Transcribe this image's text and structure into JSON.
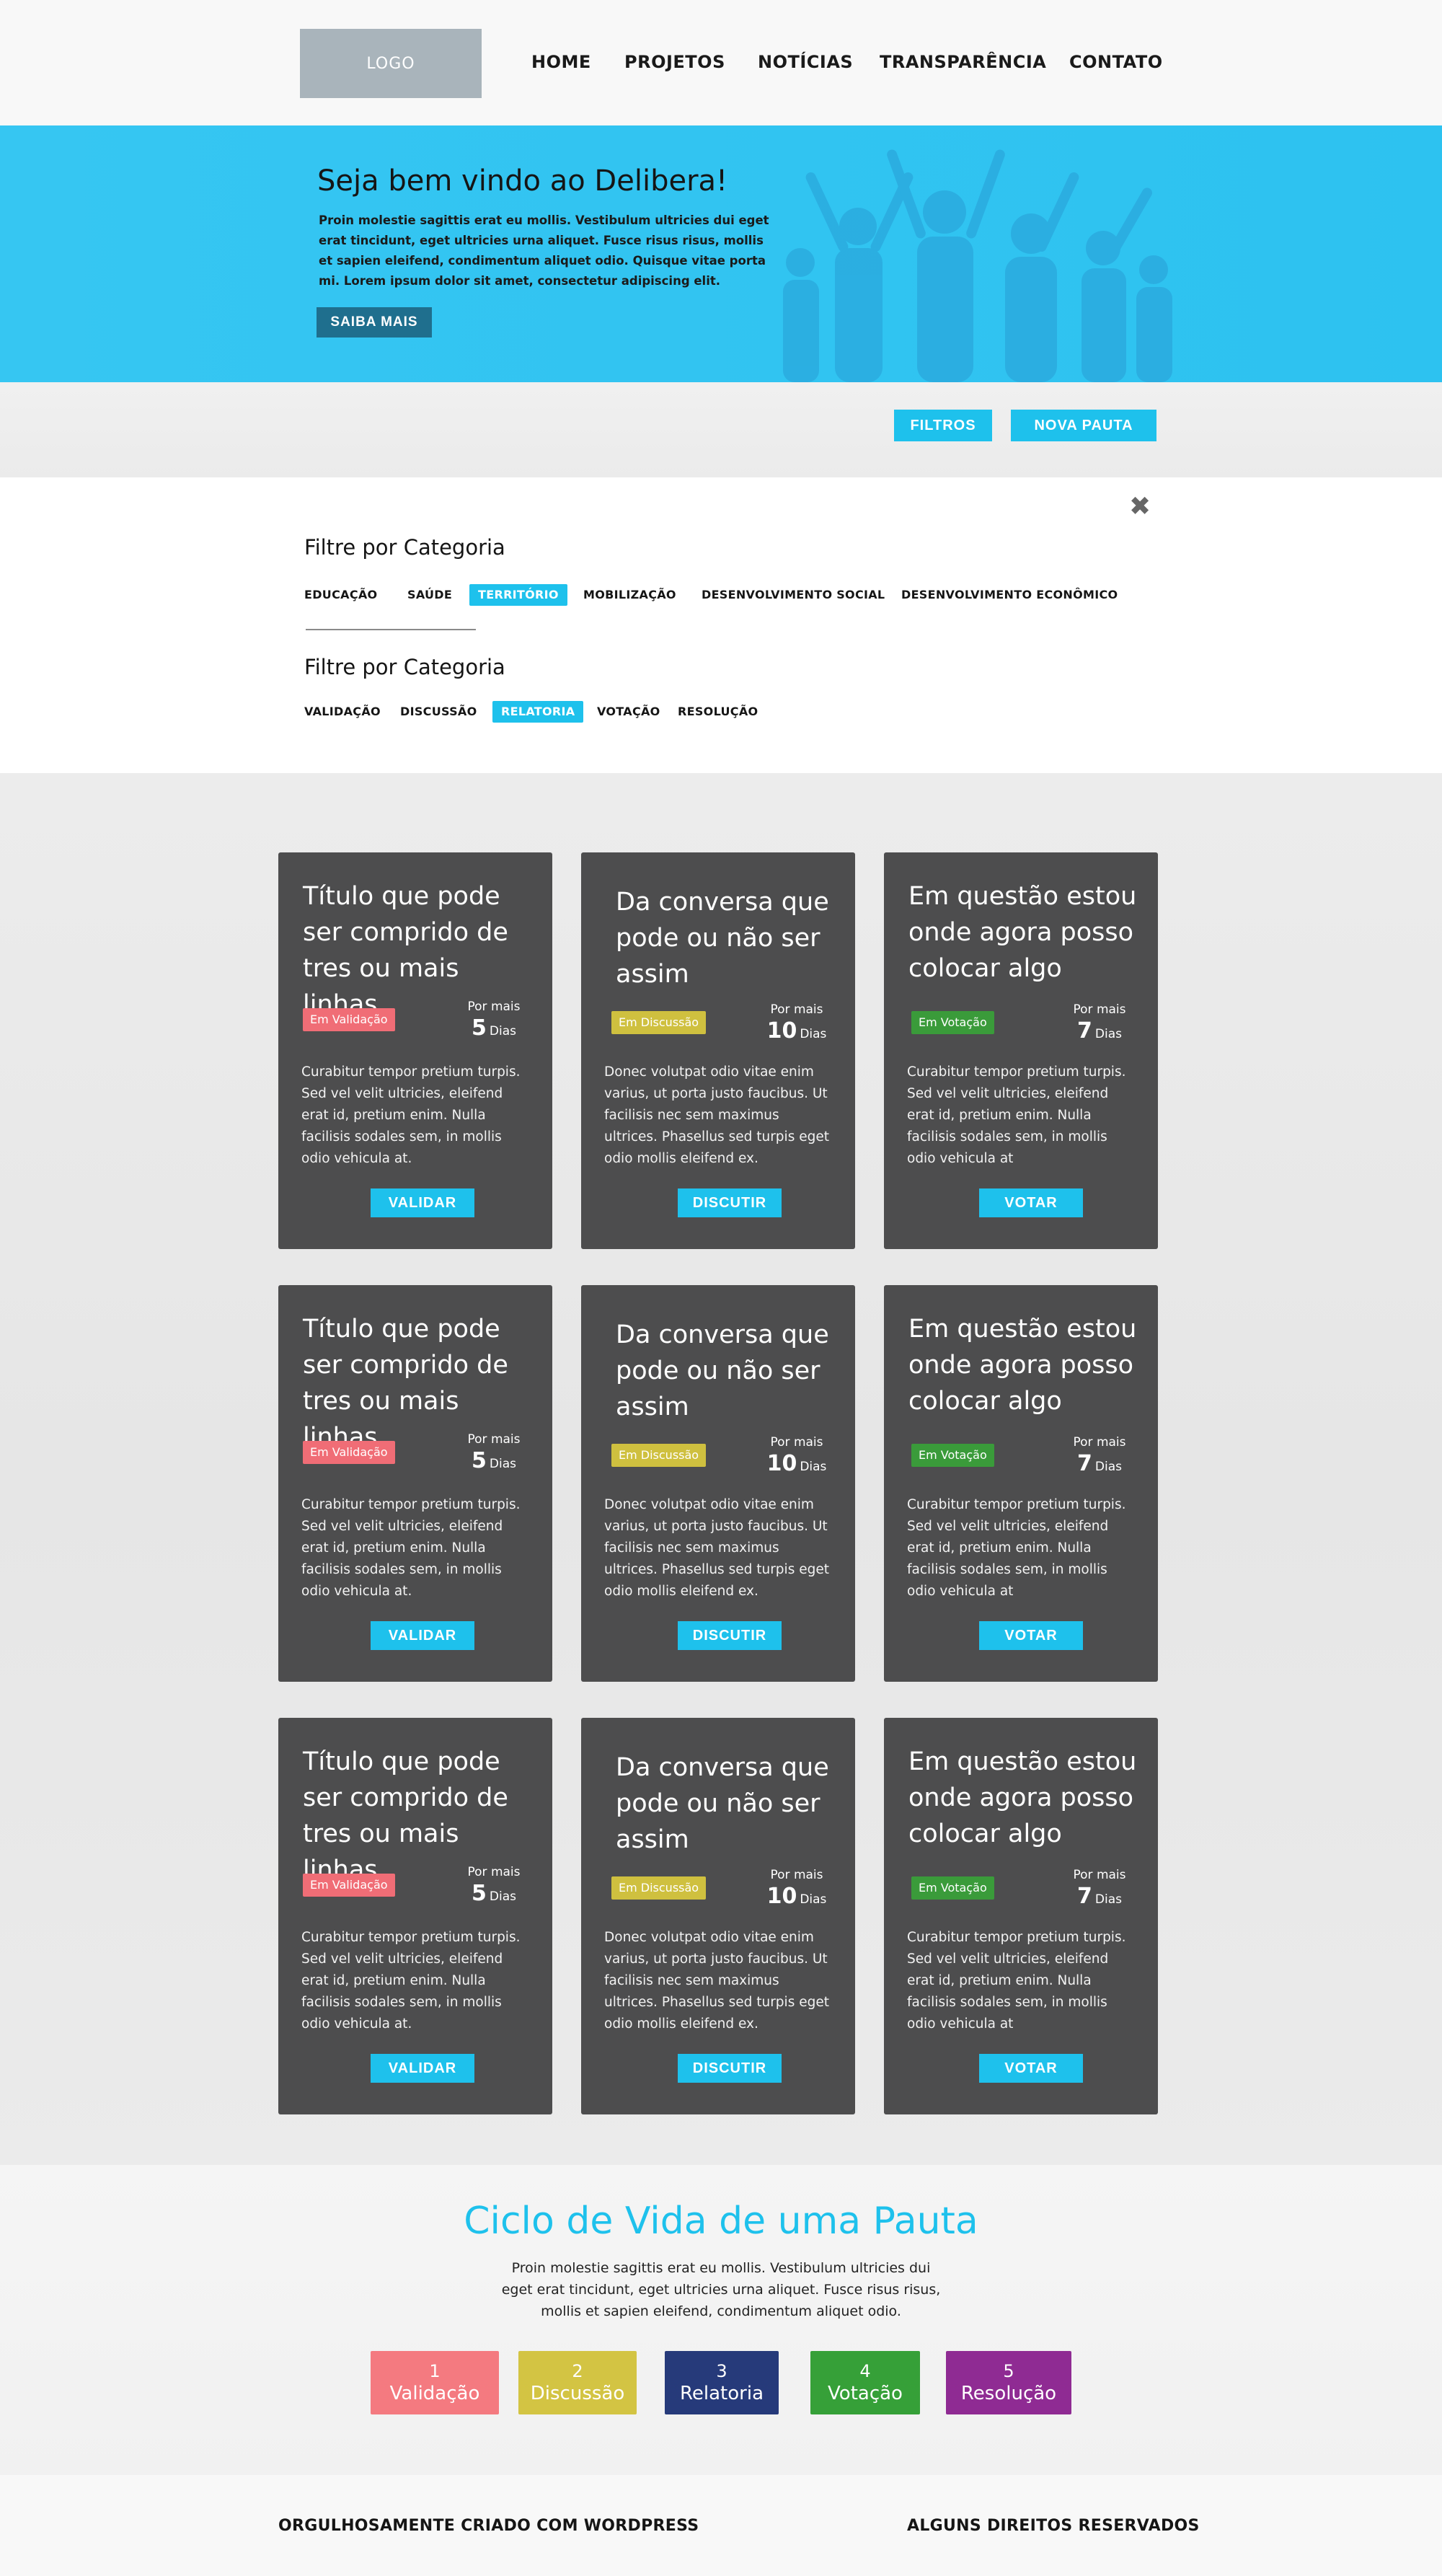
{
  "header": {
    "logo": "LOGO",
    "nav": [
      "HOME",
      "PROJETOS",
      "NOTÍCIAS",
      "TRANSPARÊNCIA",
      "CONTATO"
    ]
  },
  "hero": {
    "title": "Seja bem vindo ao Delibera!",
    "text": "Proin molestie sagittis erat eu mollis. Vestibulum ultricies dui eget erat tincidunt, eget ultricies urna aliquet. Fusce risus risus, mollis et sapien eleifend, condimentum aliquet odio. Quisque vitae porta mi. Lorem ipsum dolor sit amet, consectetur adipiscing elit.",
    "button": "SAIBA MAIS"
  },
  "actions": {
    "filters": "FILTROS",
    "new": "NOVA PAUTA"
  },
  "filters": {
    "close": "✖",
    "group1_title": "Filtre por Categoria",
    "group1": [
      "EDUCAÇÃO",
      "SAÚDE",
      "TERRITÓRIO",
      "MOBILIZAÇÃO",
      "DESENVOLVIMENTO SOCIAL",
      "DESENVOLVIMENTO ECONÔMICO"
    ],
    "group1_active": "TERRITÓRIO",
    "group2_title": "Filtre por Categoria",
    "group2": [
      "VALIDAÇÃO",
      "DISCUSSÃO",
      "RELATORIA",
      "VOTAÇÃO",
      "RESOLUÇÃO"
    ],
    "group2_active": "RELATORIA"
  },
  "cards": {
    "validacao": {
      "title": "Título que pode ser comprido de tres ou mais linhas",
      "badge": "Em Validação",
      "por_mais": "Por mais",
      "days": "5",
      "dias": "Dias",
      "desc": "Curabitur tempor pretium turpis. Sed vel velit ultricies, eleifend erat id, pretium enim. Nulla facilisis sodales sem, in mollis odio vehicula at.",
      "button": "VALIDAR",
      "badge_color": "#f06d76"
    },
    "discussao": {
      "title": "Da conversa que pode ou não ser assim",
      "badge": "Em Discussão",
      "por_mais": "Por mais",
      "days": "10",
      "dias": "Dias",
      "desc": "Donec volutpat odio vitae enim varius, ut porta justo faucibus. Ut facilisis nec sem maximus ultrices. Phasellus sed turpis eget odio mollis eleifend ex.",
      "button": "DISCUTIR",
      "badge_color": "#cfc03f"
    },
    "votacao": {
      "title": "Em questão estou onde agora posso colocar algo",
      "badge": "Em Votação",
      "por_mais": "Por mais",
      "days": "7",
      "dias": "Dias",
      "desc": "Curabitur tempor pretium turpis. Sed vel velit ultricies, eleifend erat id, pretium enim. Nulla facilisis sodales sem, in mollis odio vehicula at",
      "button": "VOTAR",
      "badge_color": "#3a9b3a"
    }
  },
  "lifecycle": {
    "title": "Ciclo de Vida de uma Pauta",
    "desc": "Proin molestie sagittis erat eu mollis. Vestibulum ultricies dui eget erat tincidunt, eget ultricies urna aliquet. Fusce risus risus, mollis et sapien eleifend, condimentum aliquet odio.",
    "stages": [
      {
        "num": "1",
        "label": "Validação",
        "color": "#f47a80"
      },
      {
        "num": "2",
        "label": "Discussão",
        "color": "#d3c443"
      },
      {
        "num": "3",
        "label": "Relatoria",
        "color": "#263a7a"
      },
      {
        "num": "4",
        "label": "Votação",
        "color": "#36a038"
      },
      {
        "num": "5",
        "label": "Resolução",
        "color": "#8f2b93"
      }
    ]
  },
  "footer": {
    "left": "ORGULHOSAMENTE CRIADO COM WORDPRESS",
    "right": "ALGUNS DIREITOS RESERVADOS"
  },
  "colors": {
    "accent": "#1ec1ec",
    "hero_bg": "#36c6f2",
    "card_bg": "#4d4d4e"
  }
}
